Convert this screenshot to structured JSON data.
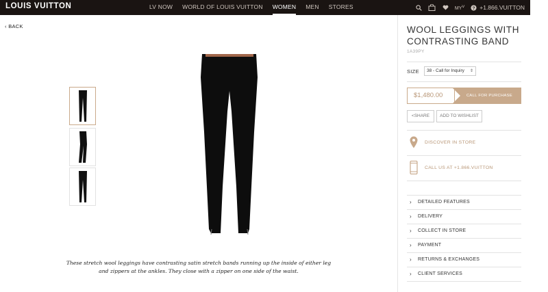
{
  "header": {
    "logo": "LOUIS VUITTON",
    "nav": [
      "LV NOW",
      "WORLD OF LOUIS VUITTON",
      "WOMEN",
      "MEN",
      "STORES"
    ],
    "active_nav": "WOMEN",
    "myl_label": "MY",
    "phone": "+1.866.VUITTON"
  },
  "back_label": "BACK",
  "product": {
    "title": "WOOL LEGGINGS WITH CONTRASTING BAND",
    "sku": "1A39PY",
    "size_label": "SIZE",
    "size_value": "38 - Call for Inquiry",
    "price": "$1,480.00",
    "call_button": "CALL FOR PURCHASE",
    "share_label": "SHARE",
    "wishlist_label": "ADD TO WISHLIST",
    "discover_label": "DISCOVER IN STORE",
    "call_us_label": "CALL US AT +1.866.VUITTON",
    "description": "These stretch wool leggings have contrasting satin stretch bands running up the inside of either leg and zippers at the ankles. They close with a zipper on one side of the waist.",
    "accordion": [
      "DETAILED FEATURES",
      "DELIVERY",
      "COLLECT IN STORE",
      "PAYMENT",
      "RETURNS & EXCHANGES",
      "CLIENT SERVICES"
    ]
  },
  "colors": {
    "topbar": "#1a1412",
    "accent_gold": "#c8a98b",
    "accent_text": "#b89676"
  },
  "icons": [
    "search-icon",
    "shopping-bag-icon",
    "heart-icon",
    "help-icon",
    "location-pin-icon",
    "mobile-phone-icon",
    "share-icon",
    "chevron-right-icon"
  ]
}
